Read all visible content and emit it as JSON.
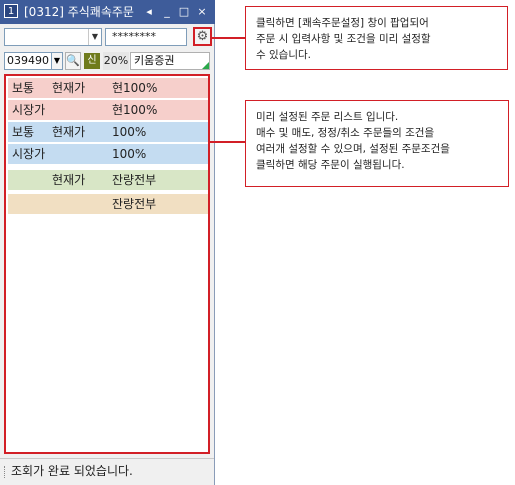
{
  "window": {
    "number": "1",
    "title": "[0312] 주식쾌속주문",
    "prev_icon": "◂",
    "min_icon": "_",
    "max_icon": "□",
    "close_icon": "×"
  },
  "account": {
    "value": "",
    "password": "********"
  },
  "stock": {
    "code": "039490",
    "credit_badge": "신",
    "margin_rate": "20%",
    "name": "키움증권"
  },
  "orders": [
    {
      "type": "보통",
      "price": "현재가",
      "qty": "현100%",
      "color": "#f6cfcb"
    },
    {
      "type": "시장가",
      "price": "",
      "qty": "현100%",
      "color": "#f6cfcb"
    },
    {
      "type": "보통",
      "price": "현재가",
      "qty": "100%",
      "color": "#c4dcf1"
    },
    {
      "type": "시장가",
      "price": "",
      "qty": "100%",
      "color": "#c4dcf1"
    },
    {
      "type": "",
      "price": "현재가",
      "qty": "잔량전부",
      "color": "#d8e6c6"
    },
    {
      "type": "",
      "price": "",
      "qty": "잔량전부",
      "color": "#f1dfc2"
    }
  ],
  "status": "조회가 완료 되었습니다.",
  "notes": {
    "settings": [
      "클릭하면 [쾌속주문설정] 창이 팝업되어",
      "주문 시 입력사항 및 조건을 미리 설정할",
      "수 있습니다."
    ],
    "list": [
      "미리 설정된 주문 리스트 입니다.",
      "매수 및 매도, 정정/취소 주문들의 조건을",
      "여러개 설정할 수 있으며, 설정된 주문조건을",
      "클릭하면 해당 주문이 실행됩니다."
    ]
  }
}
